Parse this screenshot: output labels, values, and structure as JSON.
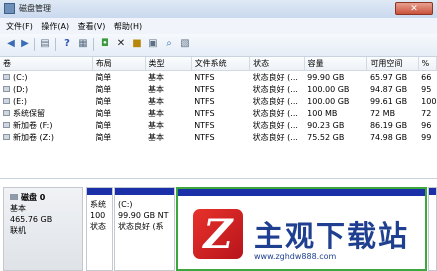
{
  "window": {
    "title": "磁盘管理"
  },
  "menu": [
    "文件(F)",
    "操作(A)",
    "查看(V)",
    "帮助(H)"
  ],
  "table": {
    "headers": [
      "卷",
      "布局",
      "类型",
      "文件系统",
      "状态",
      "容量",
      "可用空间",
      "%"
    ],
    "rows": [
      [
        "(C:)",
        "简单",
        "基本",
        "NTFS",
        "状态良好 (...",
        "99.90 GB",
        "65.97 GB",
        "66"
      ],
      [
        "(D:)",
        "简单",
        "基本",
        "NTFS",
        "状态良好 (...",
        "100.00 GB",
        "94.87 GB",
        "95"
      ],
      [
        "(E:)",
        "简单",
        "基本",
        "NTFS",
        "状态良好 (...",
        "100.00 GB",
        "99.61 GB",
        "100"
      ],
      [
        "系统保留",
        "简单",
        "基本",
        "NTFS",
        "状态良好 (...",
        "100 MB",
        "72 MB",
        "72"
      ],
      [
        "新加卷 (F:)",
        "简单",
        "基本",
        "NTFS",
        "状态良好 (...",
        "90.23 GB",
        "86.19 GB",
        "96"
      ],
      [
        "新加卷 (Z:)",
        "简单",
        "基本",
        "NTFS",
        "状态良好 (...",
        "75.52 GB",
        "74.98 GB",
        "99"
      ]
    ]
  },
  "disk": {
    "name": "磁盘 0",
    "type": "基本",
    "size": "465.76 GB",
    "status": "联机"
  },
  "partitions": [
    {
      "l1": "系统",
      "l2": "100",
      "l3": "状态"
    },
    {
      "l1": "(C:)",
      "l2": "99.90 GB  NT",
      "l3": "状态良好 (系"
    },
    {
      "l1": "",
      "l2": "",
      "l3": ""
    },
    {
      "l1": "",
      "l2": "",
      "l3": ""
    }
  ],
  "watermark": {
    "letter": "Z",
    "brand": "主观下载站",
    "url": "www.zghdw888.com"
  },
  "colors": {
    "partition_bar": "#1b2fa8",
    "selected": "#3ca73c",
    "brand": "#1f3f90",
    "logo_red": "#d8262a"
  }
}
